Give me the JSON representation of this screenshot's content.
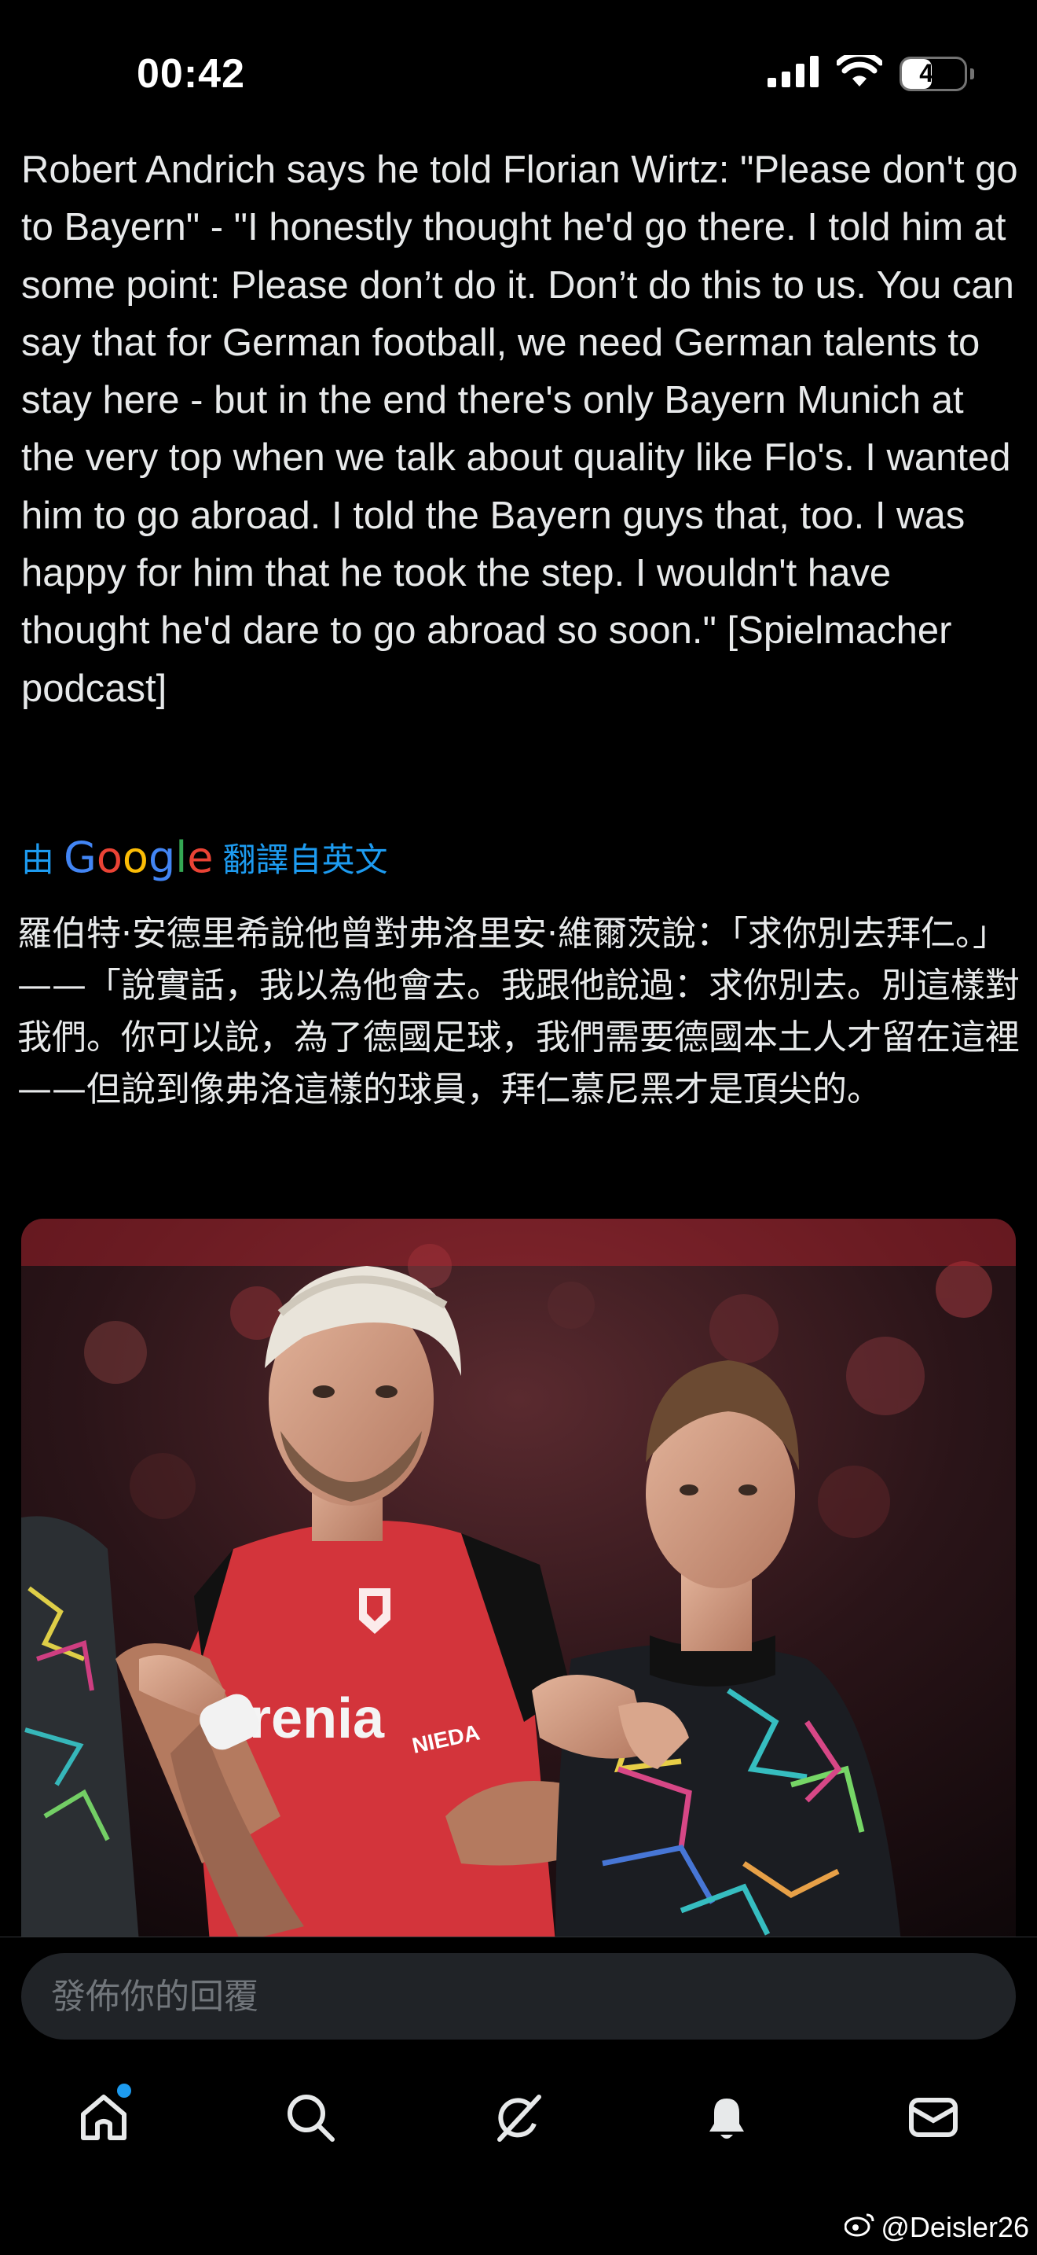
{
  "status_bar": {
    "time": "00:42",
    "battery": "48",
    "battery_level": 0.48
  },
  "tweet": {
    "text": "Robert Andrich says he told Florian Wirtz: \"Please don't go to Bayern\" - \"I honestly thought he'd go there. I told him at some point: Please don’t do it. Don’t do this to us. You can say that for German football, we need German talents to stay here - but in the end there's only Bayern Munich at the very top when we talk about quality like Flo's. I wanted him to go abroad. I told the Bayern guys that, too. I was happy for him that he took the step. I wouldn't have thought he'd dare to go abroad so soon.\" [Spielmacher podcast]",
    "translate_prefix": "由",
    "translate_brand": "Google",
    "translate_suffix": "翻譯自英文",
    "translated_text": "羅伯特·安德里希說他曾對弗洛里安·維爾茨說：「求你別去拜仁。」——「說實話，我以為他會去。我跟他說過：求你別去。別這樣對我們。你可以說，為了德國足球，我們需要德國本土人才留在這裡——但說到像弗洛這樣的球員，拜仁慕尼黑才是頂尖的。",
    "media_jersey_text": "renia",
    "media_sleeve_text": "NIEDA"
  },
  "reply": {
    "placeholder": "發佈你的回覆"
  },
  "nav": {
    "items": [
      "home-icon",
      "search-icon",
      "grok-icon",
      "notifications-icon",
      "messages-icon"
    ],
    "accent": "#1d9bf0"
  },
  "watermark": {
    "text": "@Deisler26"
  },
  "colors": {
    "background": "#000000",
    "text": "#e7e9ea",
    "link": "#1d9bf0",
    "input_bg": "#202327"
  }
}
